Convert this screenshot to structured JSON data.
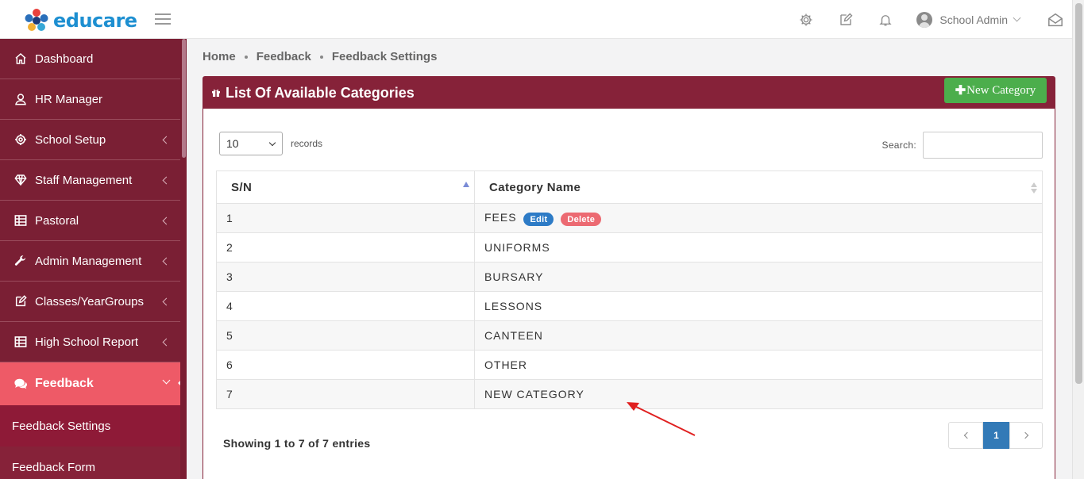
{
  "app": {
    "brand": "educare"
  },
  "header": {
    "user_name": "School Admin",
    "icons": [
      "gear-icon",
      "edit-icon",
      "bell-icon",
      "user-avatar",
      "mail-icon"
    ]
  },
  "sidebar": {
    "items": [
      {
        "label": "Dashboard",
        "icon": "home-icon"
      },
      {
        "label": "HR Manager",
        "icon": "user-icon"
      },
      {
        "label": "School Setup",
        "icon": "gear-icon"
      },
      {
        "label": "Staff Management",
        "icon": "diamond-icon"
      },
      {
        "label": "Pastoral",
        "icon": "table-icon"
      },
      {
        "label": "Admin Management",
        "icon": "wrench-icon"
      },
      {
        "label": "Classes/YearGroups",
        "icon": "edit-icon"
      },
      {
        "label": "High School Report",
        "icon": "table-icon"
      },
      {
        "label": "Feedback",
        "icon": "comments-icon"
      }
    ],
    "sub_items": [
      {
        "label": "Feedback Settings"
      },
      {
        "label": "Feedback Form"
      }
    ]
  },
  "breadcrumb": [
    "Home",
    "Feedback",
    "Feedback Settings"
  ],
  "card": {
    "title": "List Of Available Categories",
    "new_button": "New Category",
    "records_value": "10",
    "records_label": "records",
    "search_label": "Search:",
    "columns": [
      "S/N",
      "Category Name"
    ],
    "rows": [
      {
        "sn": "1",
        "name": "FEES",
        "edit": "Edit",
        "delete": "Delete"
      },
      {
        "sn": "2",
        "name": "UNIFORMS"
      },
      {
        "sn": "3",
        "name": "BURSARY"
      },
      {
        "sn": "4",
        "name": "LESSONS"
      },
      {
        "sn": "5",
        "name": "CANTEEN"
      },
      {
        "sn": "6",
        "name": "OTHER"
      },
      {
        "sn": "7",
        "name": "NEW CATEGORY"
      }
    ],
    "info": "Showing 1 to 7 of 7 entries",
    "current_page": "1"
  },
  "colors": {
    "sidebar": "#862239",
    "active": "#ee5a67",
    "success": "#4cae4c",
    "primary": "#337ab7",
    "annotation": "#e02020"
  }
}
